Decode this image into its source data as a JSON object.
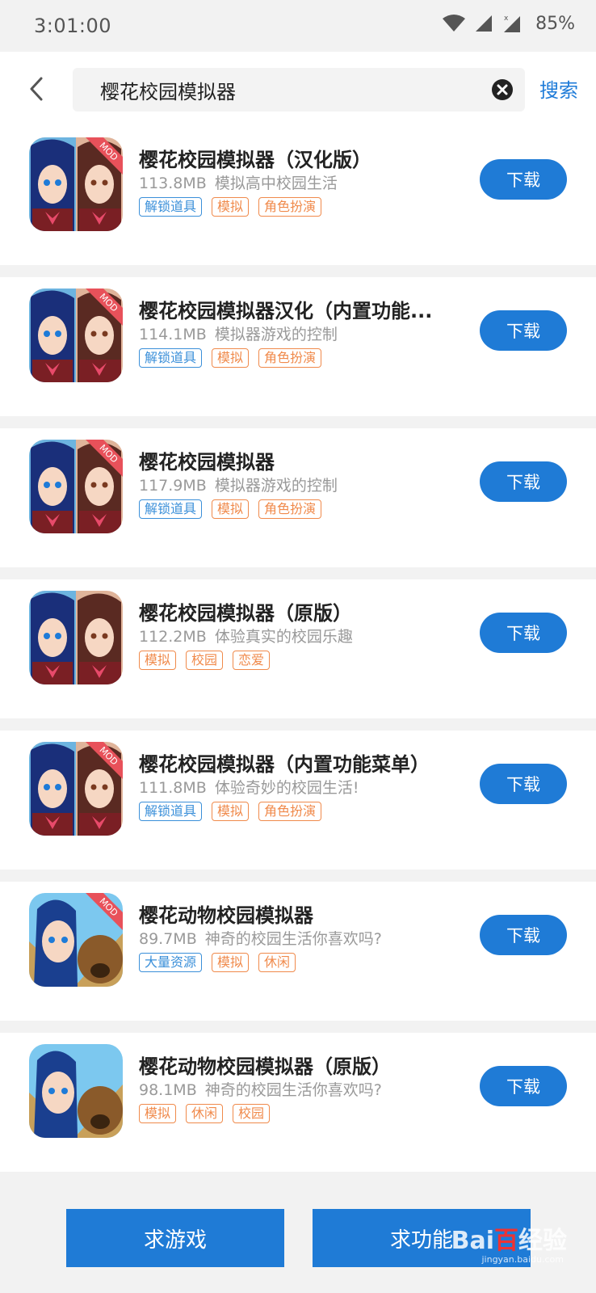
{
  "status_bar": {
    "time": "3:01:00",
    "battery": "85%",
    "icons": [
      "wifi-icon",
      "signal-icon",
      "signal-x-icon"
    ]
  },
  "search": {
    "value": "樱花校园模拟器",
    "button_label": "搜索",
    "back_icon": "chevron-left-icon",
    "clear_icon": "clear-circle-icon"
  },
  "download_label": "下载",
  "apps": [
    {
      "title": "樱花校园模拟器（汉化版）",
      "size": "113.8MB",
      "desc": "模拟高中校园生活",
      "mod": true,
      "tags": [
        {
          "label": "解锁道具",
          "color": "blue"
        },
        {
          "label": "模拟",
          "color": "orange"
        },
        {
          "label": "角色扮演",
          "color": "orange"
        }
      ]
    },
    {
      "title": "樱花校园模拟器汉化（内置功能...",
      "size": "114.1MB",
      "desc": "模拟器游戏的控制",
      "mod": true,
      "tags": [
        {
          "label": "解锁道具",
          "color": "blue"
        },
        {
          "label": "模拟",
          "color": "orange"
        },
        {
          "label": "角色扮演",
          "color": "orange"
        }
      ]
    },
    {
      "title": "樱花校园模拟器",
      "size": "117.9MB",
      "desc": "模拟器游戏的控制",
      "mod": true,
      "tags": [
        {
          "label": "解锁道具",
          "color": "blue"
        },
        {
          "label": "模拟",
          "color": "orange"
        },
        {
          "label": "角色扮演",
          "color": "orange"
        }
      ]
    },
    {
      "title": "樱花校园模拟器（原版）",
      "size": "112.2MB",
      "desc": "体验真实的校园乐趣",
      "mod": false,
      "tags": [
        {
          "label": "模拟",
          "color": "orange"
        },
        {
          "label": "校园",
          "color": "orange"
        },
        {
          "label": "恋爱",
          "color": "orange"
        }
      ]
    },
    {
      "title": "樱花校园模拟器（内置功能菜单）",
      "size": "111.8MB",
      "desc": "体验奇妙的校园生活!",
      "mod": true,
      "tags": [
        {
          "label": "解锁道具",
          "color": "blue"
        },
        {
          "label": "模拟",
          "color": "orange"
        },
        {
          "label": "角色扮演",
          "color": "orange"
        }
      ]
    },
    {
      "title": "樱花动物校园模拟器",
      "size": "89.7MB",
      "desc": "神奇的校园生活你喜欢吗?",
      "mod": true,
      "animal": true,
      "tags": [
        {
          "label": "大量资源",
          "color": "blue"
        },
        {
          "label": "模拟",
          "color": "orange"
        },
        {
          "label": "休闲",
          "color": "orange"
        }
      ]
    },
    {
      "title": "樱花动物校园模拟器（原版）",
      "size": "98.1MB",
      "desc": "神奇的校园生活你喜欢吗?",
      "mod": false,
      "animal": true,
      "tags": [
        {
          "label": "模拟",
          "color": "orange"
        },
        {
          "label": "休闲",
          "color": "orange"
        },
        {
          "label": "校园",
          "color": "orange"
        }
      ]
    }
  ],
  "bottom": {
    "request_game": "求游戏",
    "request_feature": "求功能"
  },
  "watermark": {
    "logo": "Bai百经验",
    "sub": "jingyan.baidu.com"
  },
  "colors": {
    "accent": "#1f7bd6",
    "tag_orange": "#f08a4b",
    "tag_blue": "#3a8fd9"
  }
}
